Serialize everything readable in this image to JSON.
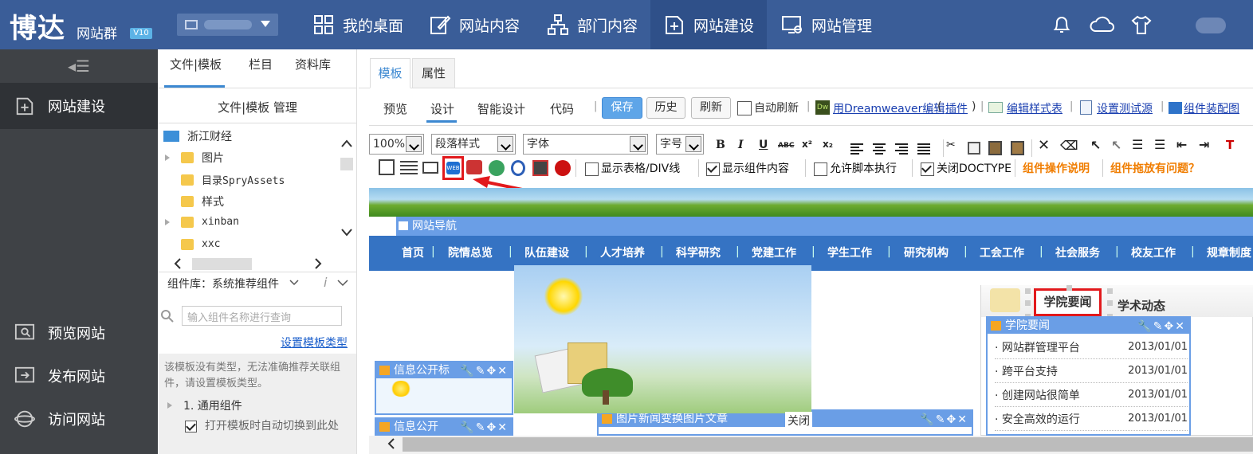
{
  "header": {
    "logo_text": "博达",
    "logo_sub": "网站群",
    "version": "V10",
    "nav": [
      {
        "label": "我的桌面",
        "icon": "grid-icon"
      },
      {
        "label": "网站内容",
        "icon": "edit-icon"
      },
      {
        "label": "部门内容",
        "icon": "org-icon"
      },
      {
        "label": "网站建设",
        "icon": "add-page-icon"
      },
      {
        "label": "网站管理",
        "icon": "monitor-gear-icon"
      }
    ],
    "active_nav": "网站建设",
    "right_icons": [
      "bell-icon",
      "cloud-icon",
      "shirt-icon",
      "user-avatar"
    ]
  },
  "sidebar": {
    "toggle_icon": "collapse-menu-icon",
    "active_item": {
      "label": "网站建设",
      "icon": "add-page-icon"
    },
    "bottom_items": [
      {
        "label": "预览网站",
        "icon": "preview-icon"
      },
      {
        "label": "发布网站",
        "icon": "publish-icon"
      },
      {
        "label": "访问网站",
        "icon": "globe-icon"
      }
    ]
  },
  "file_panel": {
    "tabs": [
      "文件|模板",
      "栏目",
      "资料库"
    ],
    "active_tab": "文件|模板",
    "title": "文件|模板 管理",
    "tree_root": "浙江财经",
    "tree_items": [
      {
        "label": "图片",
        "expandable": true
      },
      {
        "label": "目录SpryAssets",
        "expandable": false
      },
      {
        "label": "样式",
        "expandable": false
      },
      {
        "label": "xinban",
        "expandable": true
      },
      {
        "label": "xxc",
        "expandable": false
      }
    ],
    "component_lib_label": "组件库：系统推荐组件",
    "search_placeholder": "输入组件名称进行查询",
    "set_type_link": "设置模板类型",
    "note": "该模板没有类型，无法准确推荐关联组件，请设置模板类型。",
    "group_item": "1.  通用组件",
    "auto_switch_label": "打开模板时自动切换到此处",
    "auto_switch_checked": true
  },
  "editor": {
    "tabs": [
      "模板",
      "属性"
    ],
    "active_tab": "模板",
    "modes": [
      "预览",
      "设计",
      "智能设计",
      "代码"
    ],
    "active_mode": "设计",
    "buttons": {
      "save": "保存",
      "history": "历史",
      "refresh": "刷新"
    },
    "auto_refresh": {
      "label": "自动刷新",
      "checked": false
    },
    "links": {
      "dreamweaver": "用Dreamweaver编辑",
      "plugin": "插件",
      "edit_stylesheet": "编辑样式表",
      "test_source": "设置测试源",
      "assembly_view": "组件装配图"
    },
    "format_toolbar": {
      "zoom": "100%",
      "paragraph_style": "段落样式",
      "font": "字体",
      "font_size": "字号",
      "format_icons": [
        "bold-icon",
        "italic-icon",
        "underline-icon",
        "strikethrough-icon",
        "superscript-icon",
        "subscript-icon",
        "align-left-icon",
        "align-center-icon",
        "align-right-icon",
        "justify-icon",
        "cut-icon",
        "copy-icon",
        "paste-icon",
        "paste-special-icon",
        "remove-format-icon",
        "eraser-icon",
        "select-icon",
        "select-element-icon",
        "ordered-list-icon",
        "unordered-list-icon",
        "outdent-icon",
        "indent-icon",
        "text-color-icon"
      ],
      "bold_glyph": "B",
      "italic_glyph": "I",
      "underline_glyph": "U",
      "strike_glyph": "ABC"
    },
    "options": {
      "show_table_div": {
        "label": "显示表格/DIV线",
        "checked": false
      },
      "show_component": {
        "label": "显示组件内容",
        "checked": true
      },
      "allow_script": {
        "label": "允许脚本执行",
        "checked": false
      },
      "close_doctype": {
        "label": "关闭DOCTYPE",
        "checked": true
      },
      "component_help": "组件操作说明",
      "drag_problem": "组件拖放有问题？"
    }
  },
  "canvas": {
    "nav_title": "网站导航",
    "nav_items": [
      "首页",
      "院情总览",
      "队伍建设",
      "人才培养",
      "科学研究",
      "党建工作",
      "学生工作",
      "研究机构",
      "工会工作",
      "社会服务",
      "校友工作",
      "规章制度"
    ],
    "info_widget_1": "信息公开标",
    "info_widget_2": "信息公开",
    "image_news_widget": "图片新闻变换图片文章",
    "close_label": "关闭",
    "news_tabs": [
      "学院要闻",
      "学术动态"
    ],
    "news_widget_title": "学院要闻",
    "news": [
      {
        "title": "网站群管理平台",
        "date": "2013/01/01"
      },
      {
        "title": "跨平台支持",
        "date": "2013/01/01"
      },
      {
        "title": "创建网站很简单",
        "date": "2013/01/01"
      },
      {
        "title": "安全高效的运行",
        "date": "2013/01/01"
      }
    ],
    "widget_tool_icons": "wrench-icon pencil-icon move-icon close-icon"
  },
  "colors": {
    "topbar": "#3a5d98",
    "sidebar": "#3f4246",
    "accent": "#3c88d1",
    "highlight": "#e2191c",
    "orange": "#f07d00"
  }
}
